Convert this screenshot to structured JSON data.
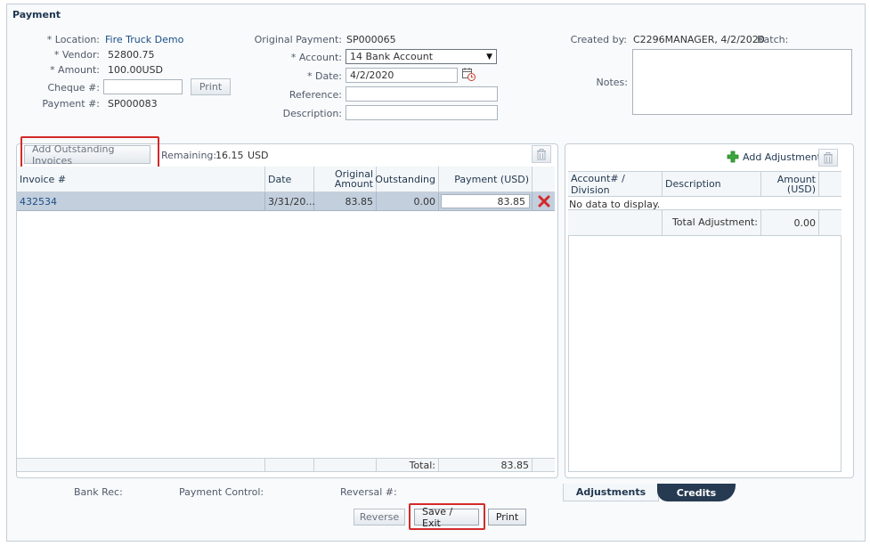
{
  "page": {
    "title": "Payment"
  },
  "form": {
    "location": {
      "label": "* Location:",
      "value": "Fire Truck Demo"
    },
    "vendor": {
      "label": "* Vendor:",
      "value": "52800.75"
    },
    "amount": {
      "label": "* Amount:",
      "value": "100.00",
      "currency": "USD"
    },
    "cheque": {
      "label": "Cheque #:",
      "value": ""
    },
    "print_label": "Print",
    "payment_no": {
      "label": "Payment #:",
      "value": "SP000083"
    },
    "original_payment": {
      "label": "Original Payment:",
      "value": "SP000065"
    },
    "account": {
      "label": "* Account:",
      "value": "14 Bank Account"
    },
    "date": {
      "label": "* Date:",
      "value": "4/2/2020"
    },
    "reference": {
      "label": "Reference:",
      "value": ""
    },
    "description": {
      "label": "Description:",
      "value": ""
    },
    "created_by": {
      "label": "Created by:",
      "value": "C2296MANAGER, 4/2/2020"
    },
    "batch": {
      "label": "Batch:",
      "value": ""
    },
    "notes": {
      "label": "Notes:",
      "value": ""
    }
  },
  "invoices": {
    "add_button": "Add Outstanding Invoices",
    "remaining_label": "Remaining:",
    "remaining_value": "16.15",
    "remaining_currency": "USD",
    "columns": [
      "Invoice #",
      "Date",
      "Original Amount",
      "Outstanding",
      "Payment (USD)"
    ],
    "rows": [
      {
        "invoice": "432534",
        "date": "3/31/20...",
        "original": "83.85",
        "outstanding": "0.00",
        "payment": "83.85"
      }
    ],
    "total_label": "Total:",
    "total_value": "83.85"
  },
  "adjustments": {
    "add_button": "Add Adjustment",
    "columns": [
      "Account# / Division",
      "Description",
      "Amount (USD)"
    ],
    "empty": "No data to display.",
    "total_label": "Total Adjustment:",
    "total_value": "0.00",
    "tabs": [
      "Adjustments",
      "Credits"
    ]
  },
  "footer": {
    "bank_rec": "Bank Rec:",
    "payment_control": "Payment Control:",
    "reversal": "Reversal #:",
    "reverse": "Reverse",
    "save_exit": "Save / Exit",
    "print": "Print"
  },
  "colors": {
    "accent_red": "#d42a2a",
    "link_blue": "#1a4e86",
    "row_selected": "#c3cfdd",
    "tab_active": "#1f3650"
  }
}
